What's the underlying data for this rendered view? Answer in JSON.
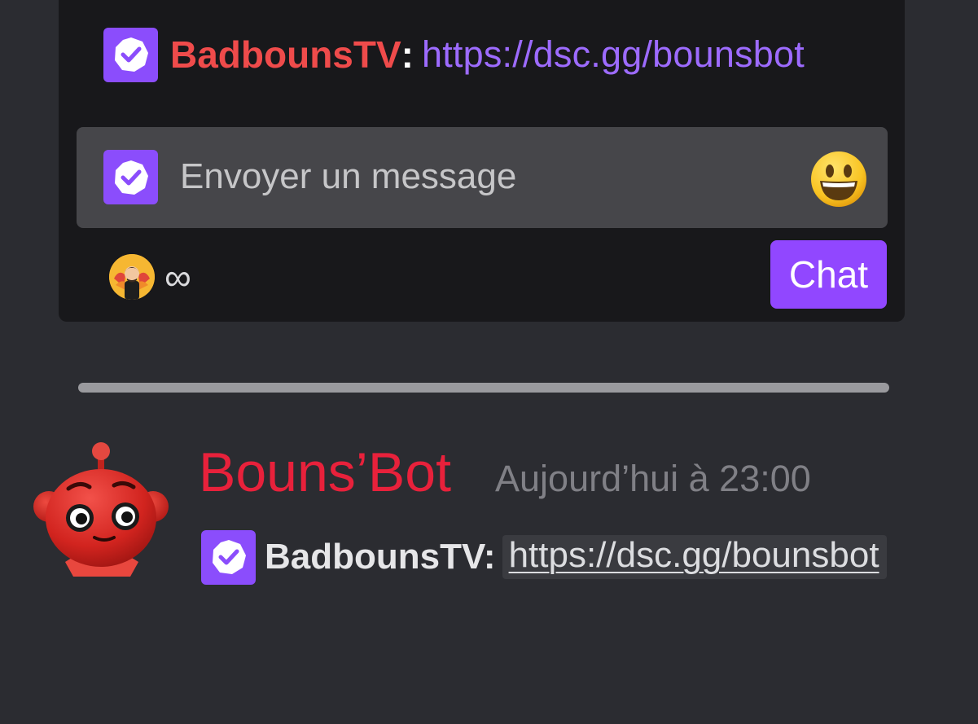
{
  "twitch_chat": {
    "message": {
      "username": "BadbounsTV",
      "separator": ":",
      "link": "https://dsc.gg/bounsbot",
      "badge_icon": "verified-badge-icon"
    },
    "input": {
      "placeholder": "Envoyer un message",
      "emoji_icon": "smiley-emoji-icon"
    },
    "channel_points": {
      "value": "∞"
    },
    "chat_button_label": "Chat"
  },
  "discord_message": {
    "author": "Bouns’Bot",
    "timestamp": "Aujourd’hui à 23:00",
    "content": {
      "username": "BadbounsTV:",
      "link": "https://dsc.gg/bounsbot"
    }
  },
  "colors": {
    "twitch_purple": "#9147ff",
    "username_red": "#ef4b4b",
    "bot_name_red": "#e8213b",
    "link_purple": "#9d6bff"
  }
}
